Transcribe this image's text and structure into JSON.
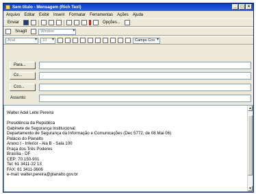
{
  "window": {
    "title": "Sem título - Mensagem (Rich Text)"
  },
  "window_controls": {
    "minimize": "_",
    "maximize": "□",
    "close": "×"
  },
  "menu": {
    "items": [
      "Arquivo",
      "Editar",
      "Exibir",
      "Inserir",
      "Formatar",
      "Ferramentas",
      "Ações",
      "Ajuda"
    ]
  },
  "toolbar1": {
    "send_label": "Enviar",
    "options_label": "Opções..."
  },
  "toolbar2": {
    "snagit_label": "SnagIt",
    "window_label": "Window"
  },
  "toolbar3": {
    "font_value": "Arial",
    "size_value": "10",
    "field_label": "Campo Cco"
  },
  "fields": {
    "para": "Para...",
    "cc": "Cc...",
    "cco": "Cco...",
    "assunto": "Assunto:"
  },
  "body_lines": [
    "Walter Adel Leite Pereira",
    "",
    "Presidência da República",
    "Gabinete de Segurança Institucional",
    "Departamento de Segurança da Informação e Comunicações (Dec 5772, de 08 Mai 06)",
    "Palácio do Planalto",
    "Anexo I - Inferior - Ala B - Sala 100",
    "Praça dos Três Poderes",
    "Brasília - DF",
    "CEP: 70.150-901",
    "Tel: 61 3411-22 13",
    "FAX: 61 3411-3606",
    "e-mail: walter.pereira@planalto.gov.br"
  ]
}
